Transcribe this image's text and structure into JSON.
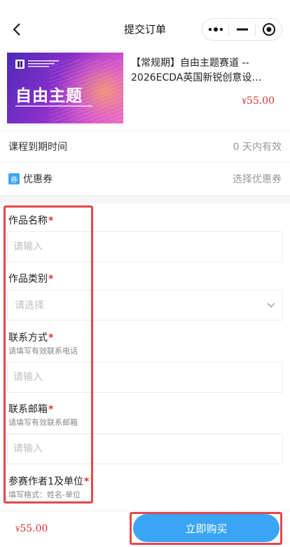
{
  "navbar": {
    "title": "提交订单",
    "back_icon": "chevron-left-icon",
    "capsule_icons": [
      "more-dots-icon",
      "minimize-icon",
      "target-close-icon"
    ]
  },
  "product": {
    "thumbnail": {
      "title": "自由主题"
    },
    "name": "【常规期】自由主题赛道 -- 2026ECDA英国新锐创意设…",
    "price_symbol": "¥",
    "price": "55.00"
  },
  "rows": {
    "expiry_label": "课程到期时间",
    "expiry_value": "0 天内有效",
    "coupon_icon_text": "券",
    "coupon_label": "优惠券",
    "coupon_value": "选择优惠券"
  },
  "form": {
    "work_name": {
      "label": "作品名称",
      "required": "*",
      "placeholder": "请输入"
    },
    "work_category": {
      "label": "作品类别",
      "required": "*",
      "placeholder": "请选择"
    },
    "contact": {
      "label": "联系方式",
      "required": "*",
      "hint": "请填写有效联系电话",
      "placeholder": "请输入"
    },
    "email": {
      "label": "联系邮箱",
      "required": "*",
      "hint": "请填写有效联系邮箱",
      "placeholder": "请输入"
    },
    "author": {
      "label": "参赛作者1及单位",
      "required": "*",
      "hint": "填写格式：姓名-单位"
    }
  },
  "bottom": {
    "price_symbol": "¥",
    "price": "55.00",
    "buy_label": "立即购买"
  },
  "colors": {
    "accent": "#3aa5f5",
    "price": "#e0312f",
    "annotation": "#e6474b"
  }
}
